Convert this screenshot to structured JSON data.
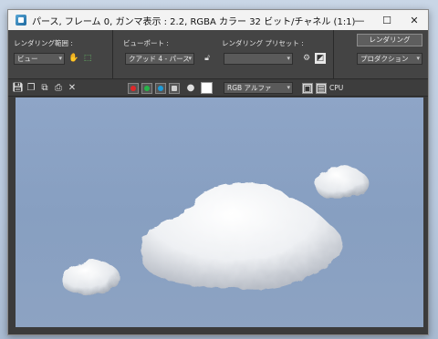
{
  "window": {
    "title": "パース, フレーム 0, ガンマ表示 : 2.2, RGBA カラー 32 ビット/チャネル (1:1)",
    "controls": {
      "minimize": "—",
      "maximize": "☐",
      "close": "✕"
    }
  },
  "panel": {
    "area_label": "レンダリング範囲 :",
    "area_value": "ビュー",
    "viewport_label": "ビューポート :",
    "viewport_value": "クアッド 4 - パース",
    "preset_label": "レンダリング プリセット :",
    "preset_value": "",
    "render_button": "レンダリング",
    "production_value": "プロダクション"
  },
  "toolbar": {
    "channel_value": "RGB アルファ",
    "cpu_label": "CPU",
    "swatch_color": "#ffffff"
  },
  "colors": {
    "red_channel": "#e0282a",
    "green_channel": "#27b44a",
    "blue_channel": "#1e9bd7",
    "background_sky": "#8ea5c7"
  }
}
